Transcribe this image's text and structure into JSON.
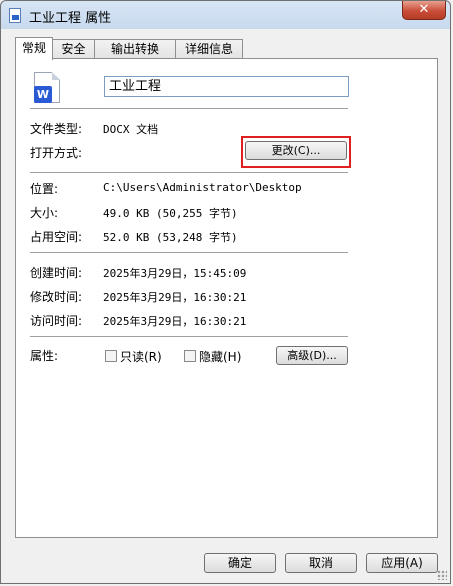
{
  "window": {
    "title": "工业工程 属性",
    "close_label": "✕"
  },
  "tabs": [
    {
      "label": "常规"
    },
    {
      "label": "安全"
    },
    {
      "label": "输出转换"
    },
    {
      "label": "详细信息"
    }
  ],
  "general": {
    "file_icon_badge": "W",
    "file_name": "工业工程",
    "file_type_label": "文件类型:",
    "file_type_value": "DOCX 文档",
    "open_with_label": "打开方式:",
    "change_button": "更改(C)...",
    "location_label": "位置:",
    "location_value": "C:\\Users\\Administrator\\Desktop",
    "size_label": "大小:",
    "size_value": "49.0 KB (50,255 字节)",
    "size_on_disk_label": "占用空间:",
    "size_on_disk_value": "52.0 KB (53,248 字节)",
    "created_label": "创建时间:",
    "created_value": "2025年3月29日，15:45:09",
    "modified_label": "修改时间:",
    "modified_value": "2025年3月29日，16:30:21",
    "accessed_label": "访问时间:",
    "accessed_value": "2025年3月29日，16:30:21",
    "attributes_label": "属性:",
    "readonly_label": "只读(R)",
    "hidden_label": "隐藏(H)",
    "advanced_button": "高级(D)..."
  },
  "footer": {
    "ok": "确定",
    "cancel": "取消",
    "apply": "应用(A)"
  },
  "colors": {
    "highlight": "#e02020",
    "word_blue": "#2a5bd4"
  }
}
